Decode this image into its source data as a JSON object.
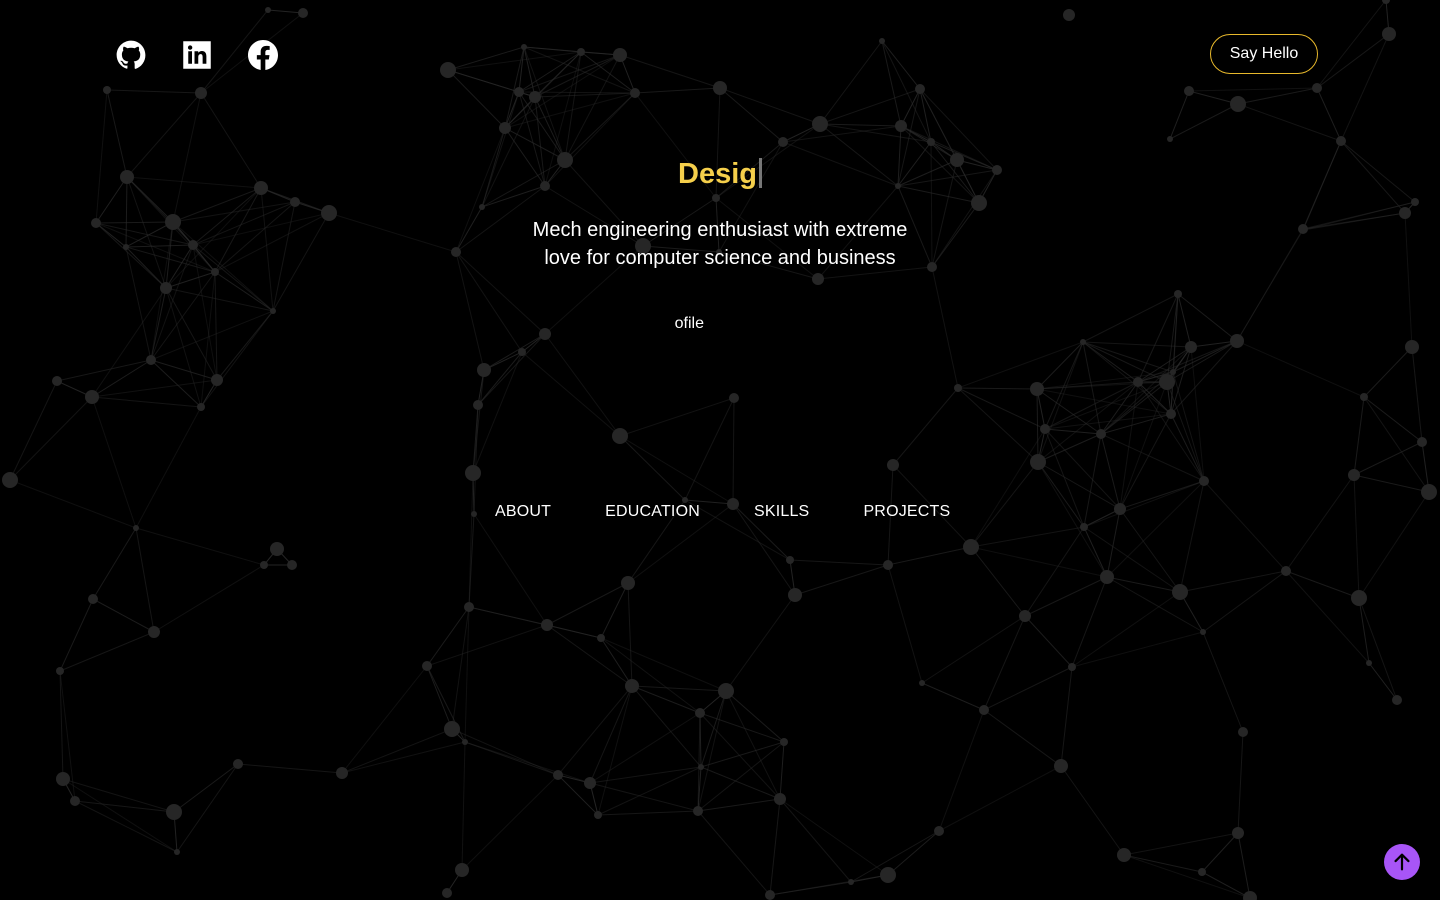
{
  "social": {
    "github_icon": "github-icon",
    "linkedin_icon": "linkedin-icon",
    "facebook_icon": "facebook-icon"
  },
  "header": {
    "say_hello_label": "Say Hello"
  },
  "hero": {
    "typed_text": "Desig",
    "tagline": "Mech engineering enthusiast with extreme love for computer science and business",
    "profile_link_visible": "ofile"
  },
  "nav": {
    "items": [
      "ABOUT",
      "EDUCATION",
      "SKILLS",
      "PROJECTS"
    ]
  },
  "scroll_top": {
    "icon": "arrow-up-icon"
  },
  "colors": {
    "background": "#000000",
    "accent_yellow": "#f5cf4b",
    "button_border": "#e8b92c",
    "scroll_top_bg": "#a855f7",
    "particle": "#3a3a3a"
  }
}
